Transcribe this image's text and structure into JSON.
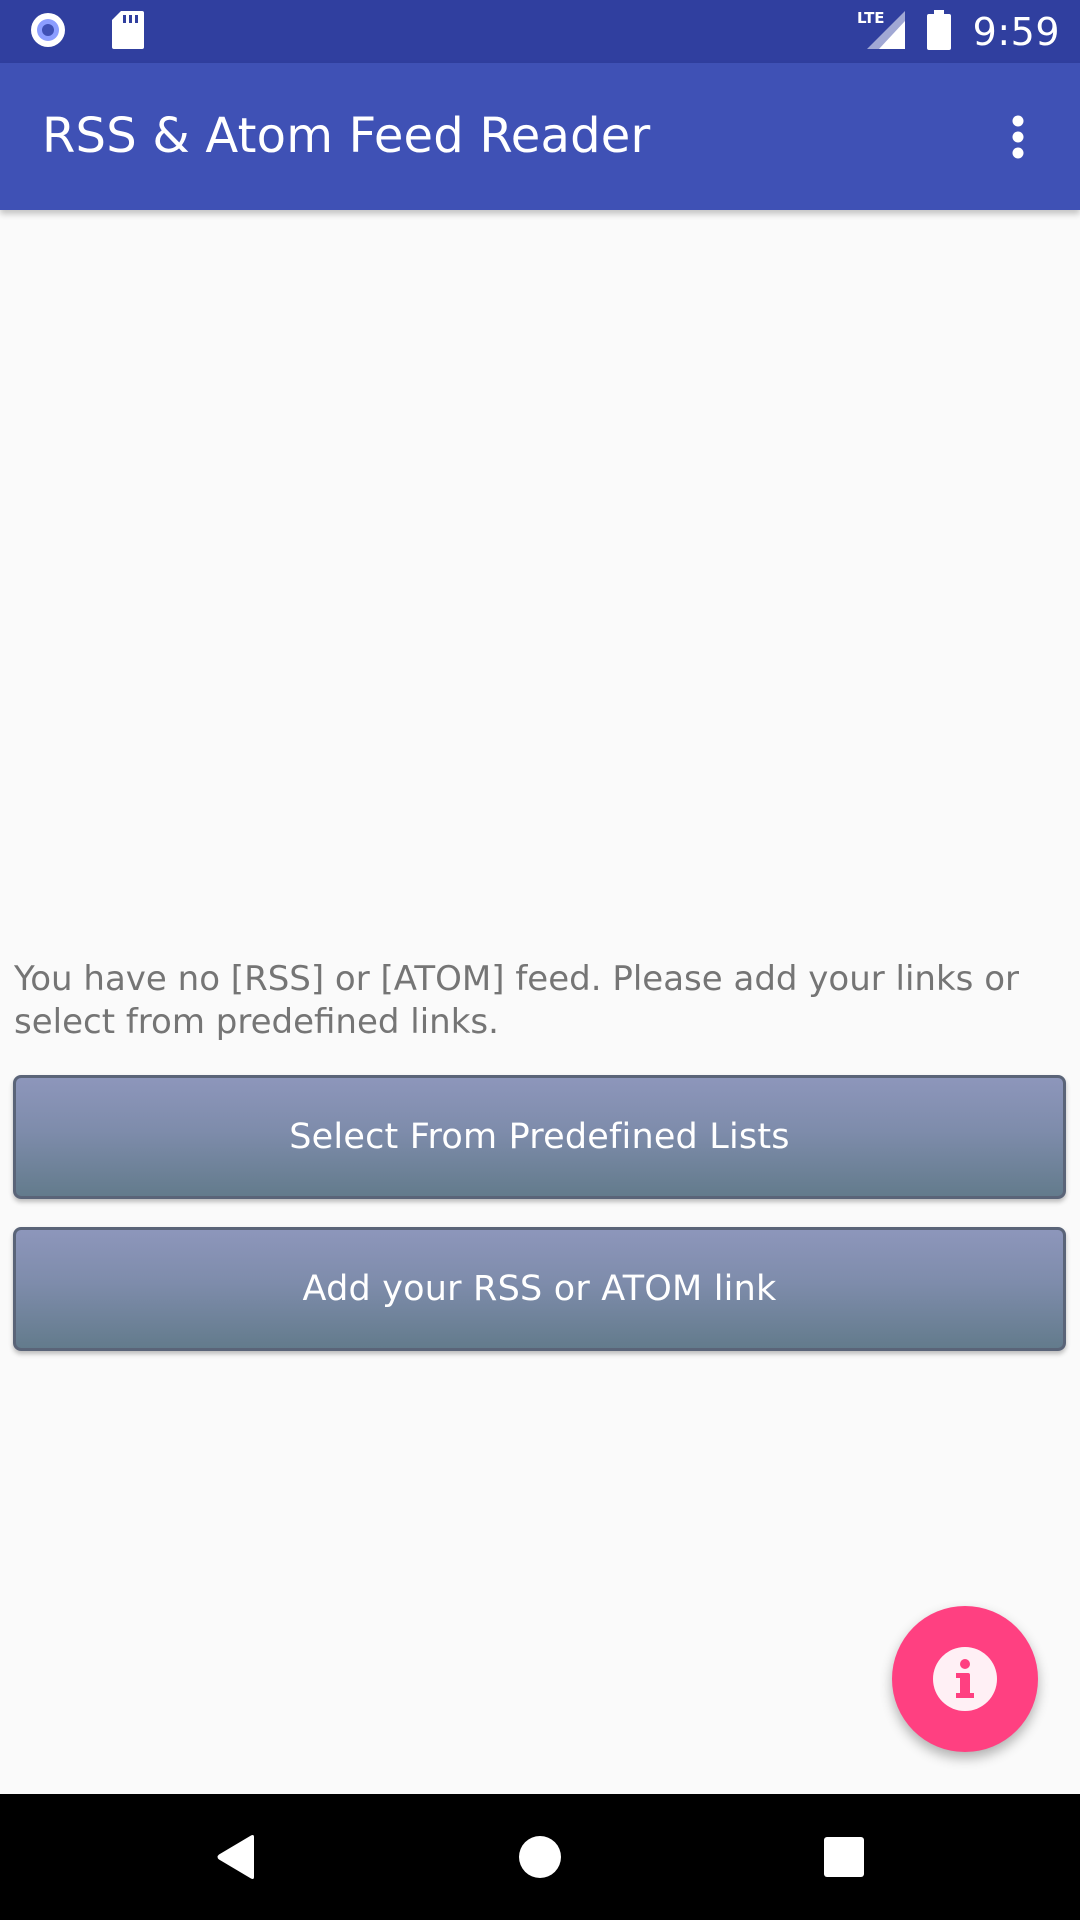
{
  "status_bar": {
    "time": "9:59",
    "network": "LTE",
    "icons": [
      "record-icon",
      "sd-card-icon",
      "lte-signal-icon",
      "battery-icon"
    ]
  },
  "app_bar": {
    "title": "RSS & Atom Feed Reader",
    "menu_icon": "overflow-menu-icon"
  },
  "content": {
    "empty_message": "You have no [RSS] or [ATOM] feed. Please add your links or select from predefined links.",
    "buttons": {
      "predefined": "Select From Predefined Lists",
      "add_link": "Add your RSS or ATOM link"
    },
    "fab_icon": "info-icon"
  },
  "nav_bar": {
    "icons": [
      "back-icon",
      "home-icon",
      "recents-icon"
    ]
  },
  "colors": {
    "status_bar": "#303f9f",
    "app_bar": "#3f51b5",
    "fab": "#ff4081",
    "background": "#fafafa",
    "message_text": "#757575"
  }
}
